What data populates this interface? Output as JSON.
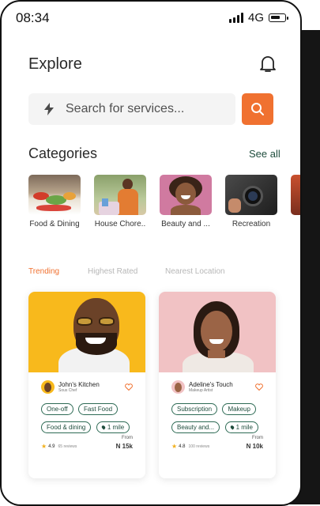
{
  "status_bar": {
    "time": "08:34",
    "network": "4G",
    "battery_level": 0.75
  },
  "header": {
    "title": "Explore",
    "notification_icon": "bell-icon"
  },
  "search": {
    "placeholder": "Search for services...",
    "icon": "bolt-icon",
    "button_icon": "search-icon"
  },
  "categories": {
    "title": "Categories",
    "see_all": "See all",
    "items": [
      {
        "label": "Food & Dining"
      },
      {
        "label": "House Chore.."
      },
      {
        "label": "Beauty and ..."
      },
      {
        "label": "Recreation"
      },
      {
        "label": ""
      }
    ]
  },
  "tabs": [
    {
      "label": "Trending",
      "active": true
    },
    {
      "label": "Highest Rated",
      "active": false
    },
    {
      "label": "Nearest Location",
      "active": false
    }
  ],
  "cards": [
    {
      "name": "John's Kitchen",
      "role": "Sous Chef",
      "tags": [
        "One-off",
        "Fast Food",
        "Food & dining",
        "1 mile"
      ],
      "rating": "4.9",
      "reviews": "65 reviews",
      "price_label": "From",
      "price": "N 15k",
      "hero_color": "#f8b91c"
    },
    {
      "name": "Adeline's Touch",
      "role": "Makeup Artist",
      "tags": [
        "Subscription",
        "Makeup",
        "Beauty and...",
        "1 mile"
      ],
      "rating": "4.8",
      "reviews": "100 reviews",
      "price_label": "From",
      "price": "N 10k",
      "hero_color": "#f1c2c4"
    }
  ],
  "colors": {
    "accent": "#f07130",
    "brand_green": "#1f4d3d"
  }
}
